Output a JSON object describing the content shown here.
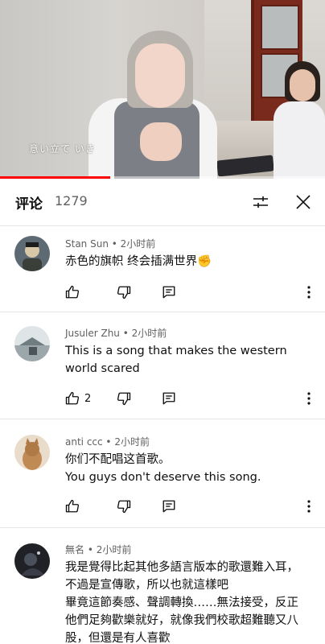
{
  "video": {
    "subtitle": "意い立て いき",
    "progress_fraction": 0.34
  },
  "comments_header": {
    "title": "评论",
    "count": "1279"
  },
  "comments": [
    {
      "author": "Stan Sun",
      "time": "2小时前",
      "text": "赤色的旗帜 终会插满世界✊",
      "likes": ""
    },
    {
      "author": "Jusuler Zhu",
      "time": "2小时前",
      "text": "This is a song that makes the western world scared",
      "likes": "2"
    },
    {
      "author": "anti ccc",
      "time": "2小时前",
      "text": "你们不配唱这首歌。\nYou guys don't deserve this song.",
      "likes": ""
    },
    {
      "author": "無名",
      "time": "2小时前",
      "text": "我是覺得比起其他多語言版本的歌還難入耳，不過是宣傳歌，所以也就這樣吧\n畢竟這節奏感、聲調轉換……無法接受，反正他們足夠歡樂就好，就像我們校歌超難聽又八股，但還是有人喜歡",
      "likes": ""
    }
  ],
  "separator": " • ",
  "colors": {
    "progress": "#ff0000",
    "text_primary": "#0f0f0f",
    "text_secondary": "#606060",
    "divider": "#e5e5e5"
  },
  "icons": [
    "sliders-icon",
    "close-icon",
    "thumbs-up-icon",
    "thumbs-down-icon",
    "reply-icon",
    "more-vertical-icon"
  ]
}
